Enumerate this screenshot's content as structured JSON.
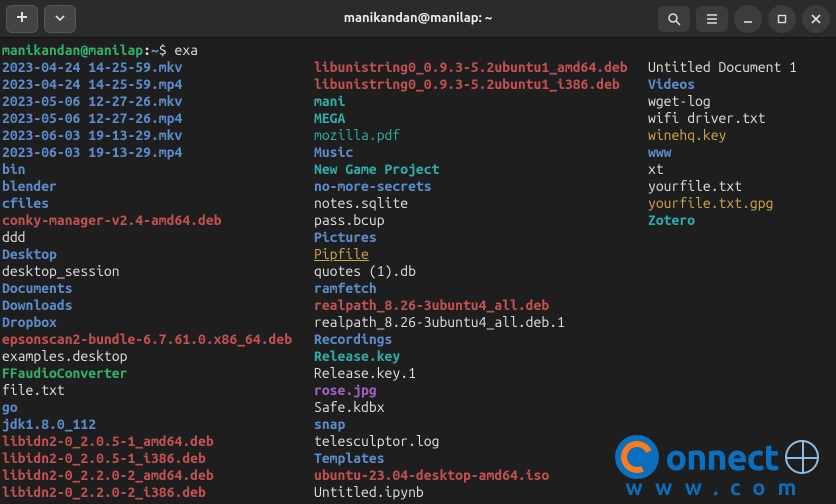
{
  "window": {
    "title": "manikandan@manilap: ~"
  },
  "prompt": {
    "user_host": "manikandan@manilap",
    "path": "~",
    "command": "exa"
  },
  "columns": [
    [
      {
        "name": "2023-04-24 14-25-59.mkv",
        "cls": "c-vid"
      },
      {
        "name": "2023-04-24 14-25-59.mp4",
        "cls": "c-vid"
      },
      {
        "name": "2023-05-06 12-27-26.mkv",
        "cls": "c-vid"
      },
      {
        "name": "2023-05-06 12-27-26.mp4",
        "cls": "c-vid"
      },
      {
        "name": "2023-06-03 19-13-29.mkv",
        "cls": "c-vid"
      },
      {
        "name": "2023-06-03 19-13-29.mp4",
        "cls": "c-vid"
      },
      {
        "name": "bin",
        "cls": "c-dir"
      },
      {
        "name": "blender",
        "cls": "c-dir"
      },
      {
        "name": "cfiles",
        "cls": "c-dir"
      },
      {
        "name": "conky-manager-v2.4-amd64.deb",
        "cls": "c-deb"
      },
      {
        "name": "ddd",
        "cls": "c-file"
      },
      {
        "name": "Desktop",
        "cls": "c-dir"
      },
      {
        "name": "desktop_session",
        "cls": "c-file"
      },
      {
        "name": "Documents",
        "cls": "c-dir"
      },
      {
        "name": "Downloads",
        "cls": "c-dir"
      },
      {
        "name": "Dropbox",
        "cls": "c-dir"
      },
      {
        "name": "epsonscan2-bundle-6.7.61.0.x86_64.deb",
        "cls": "c-deb"
      },
      {
        "name": "examples.desktop",
        "cls": "c-file"
      },
      {
        "name": "FFaudioConverter",
        "cls": "c-link"
      },
      {
        "name": "file.txt",
        "cls": "c-file"
      },
      {
        "name": "go",
        "cls": "c-dir"
      },
      {
        "name": "jdk1.8.0_112",
        "cls": "c-dir"
      },
      {
        "name": "libidn2-0_2.0.5-1_amd64.deb",
        "cls": "c-deb"
      },
      {
        "name": "libidn2-0_2.0.5-1_i386.deb",
        "cls": "c-deb"
      },
      {
        "name": "libidn2-0_2.2.0-2_amd64.deb",
        "cls": "c-deb"
      },
      {
        "name": "libidn2-0_2.2.0-2_i386.deb",
        "cls": "c-deb"
      }
    ],
    [
      {
        "name": "libunistring0_0.9.3-5.2ubuntu1_amd64.deb",
        "cls": "c-deb"
      },
      {
        "name": "libunistring0_0.9.3-5.2ubuntu1_i386.deb",
        "cls": "c-deb"
      },
      {
        "name": "mani",
        "cls": "c-tealb"
      },
      {
        "name": "MEGA",
        "cls": "c-tealb"
      },
      {
        "name": "mozilla.pdf",
        "cls": "c-teal"
      },
      {
        "name": "Music",
        "cls": "c-dir"
      },
      {
        "name": "New Game Project",
        "cls": "c-tealb"
      },
      {
        "name": "no-more-secrets",
        "cls": "c-dir"
      },
      {
        "name": "notes.sqlite",
        "cls": "c-file"
      },
      {
        "name": "pass.bcup",
        "cls": "c-file"
      },
      {
        "name": "Pictures",
        "cls": "c-dir"
      },
      {
        "name": "Pipfile",
        "cls": "c-keyu"
      },
      {
        "name": "quotes (1).db",
        "cls": "c-file"
      },
      {
        "name": "ramfetch",
        "cls": "c-dir"
      },
      {
        "name": "realpath_8.26-3ubuntu4_all.deb",
        "cls": "c-deb"
      },
      {
        "name": "realpath_8.26-3ubuntu4_all.deb.1",
        "cls": "c-file"
      },
      {
        "name": "Recordings",
        "cls": "c-dir"
      },
      {
        "name": "Release.key",
        "cls": "c-tealb"
      },
      {
        "name": "Release.key.1",
        "cls": "c-file"
      },
      {
        "name": "rose.jpg",
        "cls": "c-pic"
      },
      {
        "name": "Safe.kdbx",
        "cls": "c-file"
      },
      {
        "name": "snap",
        "cls": "c-dir"
      },
      {
        "name": "telesculptor.log",
        "cls": "c-file"
      },
      {
        "name": "Templates",
        "cls": "c-dir"
      },
      {
        "name": "ubuntu-23.04-desktop-amd64.iso",
        "cls": "c-iso"
      },
      {
        "name": "Untitled.ipynb",
        "cls": "c-file"
      }
    ],
    [
      {
        "name": "Untitled Document 1",
        "cls": "c-file"
      },
      {
        "name": "Videos",
        "cls": "c-dir"
      },
      {
        "name": "wget-log",
        "cls": "c-file"
      },
      {
        "name": "wifi driver.txt",
        "cls": "c-file"
      },
      {
        "name": "winehq.key",
        "cls": "c-key"
      },
      {
        "name": "www",
        "cls": "c-dir"
      },
      {
        "name": "xt",
        "cls": "c-file"
      },
      {
        "name": "yourfile.txt",
        "cls": "c-file"
      },
      {
        "name": "yourfile.txt.gpg",
        "cls": "c-key"
      },
      {
        "name": "Zotero",
        "cls": "c-tealb"
      }
    ]
  ],
  "watermark": {
    "line1": "onnect",
    "line2": "www.com"
  }
}
